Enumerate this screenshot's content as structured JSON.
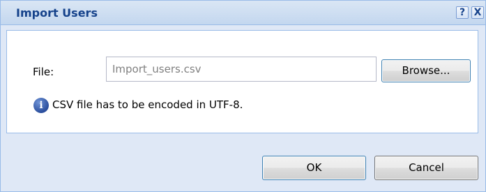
{
  "dialog": {
    "title": "Import Users",
    "help_label": "?",
    "close_label": "X"
  },
  "form": {
    "file_label": "File:",
    "file_value": "Import_users.csv",
    "browse_label": "Browse...",
    "info_icon_glyph": "i",
    "info_text": "CSV file has to be encoded in UTF-8."
  },
  "footer": {
    "ok_label": "OK",
    "cancel_label": "Cancel"
  },
  "colors": {
    "title_text": "#15428b",
    "frame": "#dfe8f6",
    "border": "#99bbe8",
    "info_icon": "#2a4e9d"
  }
}
